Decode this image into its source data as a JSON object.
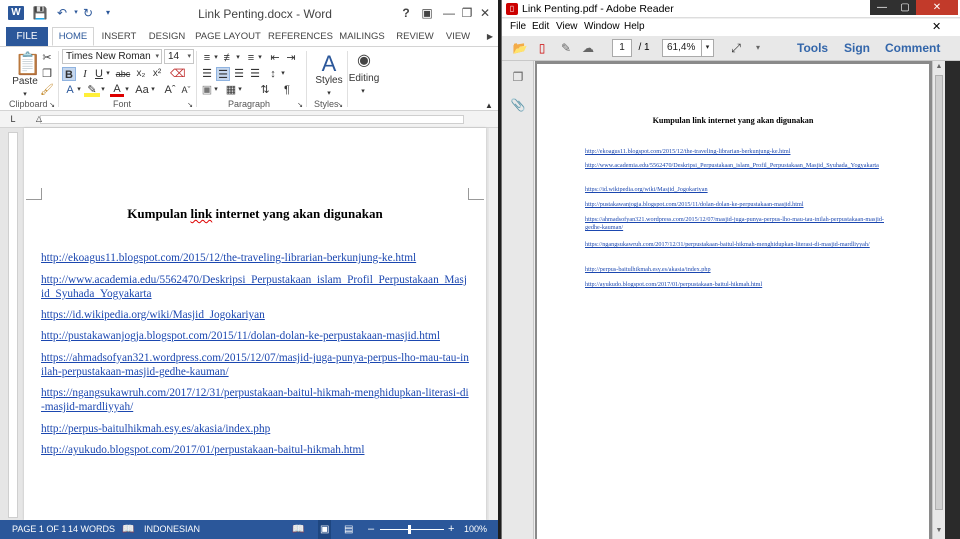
{
  "word": {
    "window_title": "Link Penting.docx - Word",
    "logo": "W",
    "tabs": [
      "FILE",
      "HOME",
      "INSERT",
      "DESIGN",
      "PAGE LAYOUT",
      "REFERENCES",
      "MAILINGS",
      "REVIEW",
      "VIEW"
    ],
    "ribbon": {
      "paste_label": "Paste",
      "font_name": "Times New Roman",
      "font_size": "14",
      "styles_label": "Styles",
      "editing_label": "Editing",
      "groups": [
        "Clipboard",
        "Font",
        "Paragraph",
        "Styles"
      ]
    },
    "document": {
      "heading_pre": "Kumpulan ",
      "heading_sq": "link",
      "heading_post": " internet yang akan digunakan",
      "links": [
        "http://ekoagus11.blogspot.com/2015/12/the-traveling-librarian-berkunjung-ke.html",
        "http://www.academia.edu/5562470/Deskripsi_Perpustakaan_islam_Profil_Perpustakaan_Masjid_Syuhada_Yogyakarta",
        "https://id.wikipedia.org/wiki/Masjid_Jogokariyan",
        "http://pustakawanjogja.blogspot.com/2015/11/dolan-dolan-ke-perpustakaan-masjid.html",
        "https://ahmadsofyan321.wordpress.com/2015/12/07/masjid-juga-punya-perpus-lho-mau-tau-inilah-perpustakaan-masjid-gedhe-kauman/",
        "https://ngangsukawruh.com/2017/12/31/perpustakaan-baitul-hikmah-menghidupkan-literasi-di-masjid-mardliyyah/",
        "http://perpus-baitulhikmah.esy.es/akasia/index.php",
        "http://ayukudo.blogspot.com/2017/01/perpustakaan-baitul-hikmah.html"
      ]
    },
    "status": {
      "page": "PAGE 1 OF 1",
      "words": "14 WORDS",
      "language": "INDONESIAN",
      "zoom": "100%"
    },
    "colors": {
      "accent": "#2b579a",
      "link": "#1b47b0"
    }
  },
  "reader": {
    "window_title": "Link Penting.pdf - Adobe Reader",
    "menu": [
      "File",
      "Edit",
      "View",
      "Window",
      "Help"
    ],
    "page_current": "1",
    "page_total": "/ 1",
    "zoom": "61,4%",
    "buttons": [
      "Tools",
      "Sign",
      "Comment"
    ],
    "document": {
      "heading": "Kumpulan link internet yang akan digunakan"
    }
  }
}
